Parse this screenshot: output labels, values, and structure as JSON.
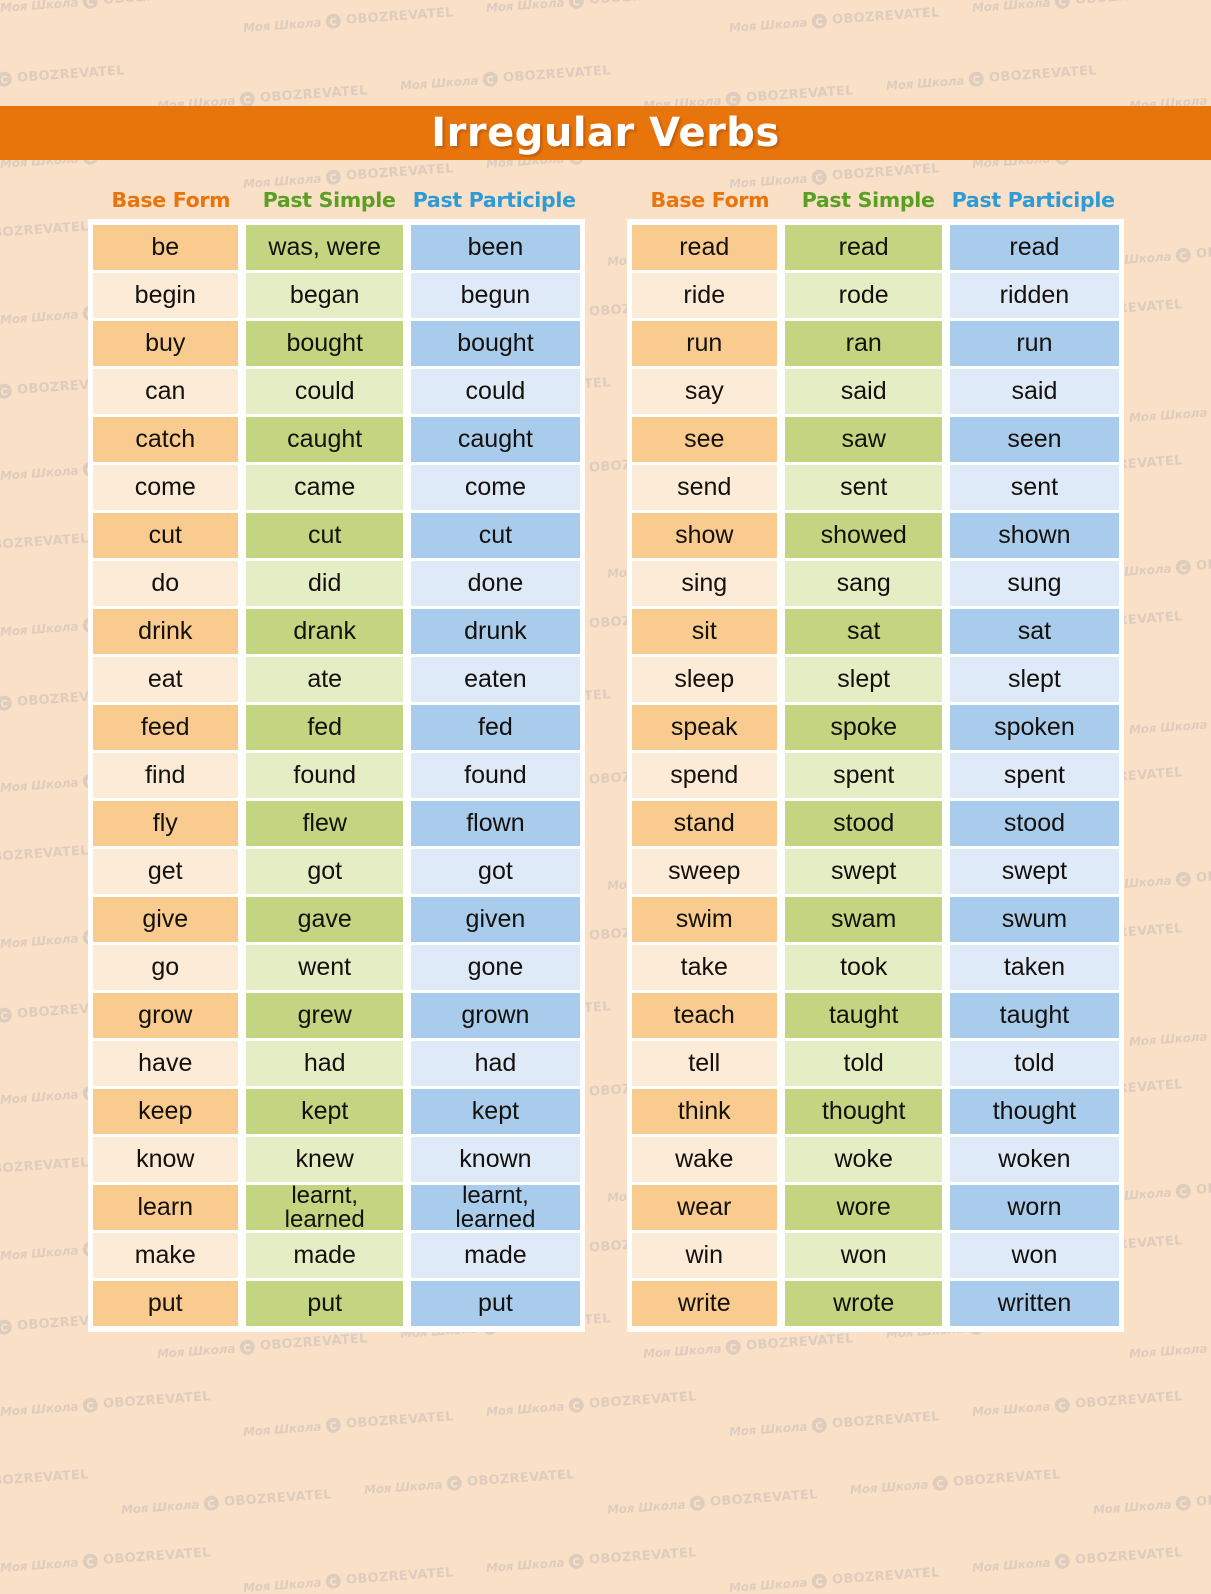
{
  "title": "Irregular Verbs",
  "theme": {
    "page_background": "#FBE0C8",
    "banner": "#E8740C",
    "base_form_color": "#E8740C",
    "past_simple_color": "#59A022",
    "past_participle_color": "#2C9BD6",
    "cell_orange_strong": "#F9CB8F",
    "cell_orange_pale": "#FCEBD6",
    "cell_green_strong": "#C3D580",
    "cell_green_pale": "#E5EDC5",
    "cell_blue_strong": "#A9CCEC",
    "cell_blue_pale": "#DFEAF8"
  },
  "watermark": {
    "school_text": "Моя Школа",
    "brand_text": "OBOZREVATEL",
    "icon": "refresh-circle-icon"
  },
  "columns": [
    "Base Form",
    "Past Simple",
    "Past Participle"
  ],
  "tables": [
    {
      "id": "left",
      "headers": [
        "Base Form",
        "Past Simple",
        "Past Participle"
      ],
      "rows": [
        [
          "be",
          "was, were",
          "been"
        ],
        [
          "begin",
          "began",
          "begun"
        ],
        [
          "buy",
          "bought",
          "bought"
        ],
        [
          "can",
          "could",
          "could"
        ],
        [
          "catch",
          "caught",
          "caught"
        ],
        [
          "come",
          "came",
          "come"
        ],
        [
          "cut",
          "cut",
          "cut"
        ],
        [
          "do",
          "did",
          "done"
        ],
        [
          "drink",
          "drank",
          "drunk"
        ],
        [
          "eat",
          "ate",
          "eaten"
        ],
        [
          "feed",
          "fed",
          "fed"
        ],
        [
          "find",
          "found",
          "found"
        ],
        [
          "fly",
          "flew",
          "flown"
        ],
        [
          "get",
          "got",
          "got"
        ],
        [
          "give",
          "gave",
          "given"
        ],
        [
          "go",
          "went",
          "gone"
        ],
        [
          "grow",
          "grew",
          "grown"
        ],
        [
          "have",
          "had",
          "had"
        ],
        [
          "keep",
          "kept",
          "kept"
        ],
        [
          "know",
          "knew",
          "known"
        ],
        [
          "learn",
          "learnt,\nlearned",
          "learnt,\nlearned"
        ],
        [
          "make",
          "made",
          "made"
        ],
        [
          "put",
          "put",
          "put"
        ]
      ]
    },
    {
      "id": "right",
      "headers": [
        "Base Form",
        "Past Simple",
        "Past Participle"
      ],
      "rows": [
        [
          "read",
          "read",
          "read"
        ],
        [
          "ride",
          "rode",
          "ridden"
        ],
        [
          "run",
          "ran",
          "run"
        ],
        [
          "say",
          "said",
          "said"
        ],
        [
          "see",
          "saw",
          "seen"
        ],
        [
          "send",
          "sent",
          "sent"
        ],
        [
          "show",
          "showed",
          "shown"
        ],
        [
          "sing",
          "sang",
          "sung"
        ],
        [
          "sit",
          "sat",
          "sat"
        ],
        [
          "sleep",
          "slept",
          "slept"
        ],
        [
          "speak",
          "spoke",
          "spoken"
        ],
        [
          "spend",
          "spent",
          "spent"
        ],
        [
          "stand",
          "stood",
          "stood"
        ],
        [
          "sweep",
          "swept",
          "swept"
        ],
        [
          "swim",
          "swam",
          "swum"
        ],
        [
          "take",
          "took",
          "taken"
        ],
        [
          "teach",
          "taught",
          "taught"
        ],
        [
          "tell",
          "told",
          "told"
        ],
        [
          "think",
          "thought",
          "thought"
        ],
        [
          "wake",
          "woke",
          "woken"
        ],
        [
          "wear",
          "wore",
          "worn"
        ],
        [
          "win",
          "won",
          "won"
        ],
        [
          "write",
          "wrote",
          "written"
        ]
      ]
    }
  ]
}
